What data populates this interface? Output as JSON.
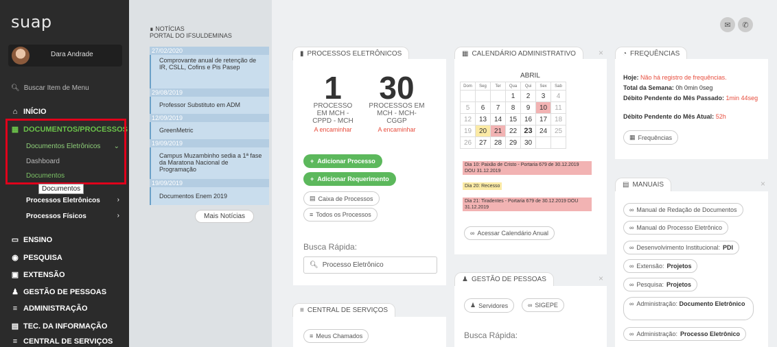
{
  "sidebar": {
    "logo": "suap",
    "user_name": "Dara Andrade",
    "search_placeholder": "Buscar Item de Menu",
    "items": {
      "inicio": "INÍCIO",
      "documentos": "DOCUMENTOS/PROCESSOS",
      "doc_eletronicos": "Documentos Eletrônicos",
      "dashboard": "Dashboard",
      "documentos_sub": "Documentos",
      "proc_eletronicos": "Processos Eletrônicos",
      "proc_fisicos": "Processos Físicos",
      "ensino": "ENSINO",
      "pesquisa": "PESQUISA",
      "extensao": "EXTENSÃO",
      "gestao": "GESTÃO DE PESSOAS",
      "administracao": "ADMINISTRAÇÃO",
      "tec": "TEC. DA INFORMAÇÃO",
      "central": "CENTRAL DE SERVIÇOS"
    },
    "tooltip": "Documentos",
    "highlight_color": "#e0001b"
  },
  "news": {
    "title": "NOTÍCIAS",
    "subtitle": "PORTAL DO IFSULDEMINAS",
    "items": [
      {
        "date": "27/02/2020",
        "title": "Comprovante anual de retenção de IR, CSLL, Cofins e Pis Pasep"
      },
      {
        "date": "29/08/2019",
        "title": "Professor Substituto em ADM"
      },
      {
        "date": "12/09/2019",
        "title": "GreenMetric"
      },
      {
        "date": "19/09/2019",
        "title": "Campus Muzambinho sedia a 1ª fase da Maratona Nacional de Programação"
      },
      {
        "date": "19/09/2019",
        "title": "Documentos Enem 2019"
      }
    ],
    "more": "Mais Notícias"
  },
  "processos": {
    "tab": "PROCESSOS ELETRÔNICOS",
    "n1": "1",
    "label1": "PROCESSO EM MCH - CPPD - MCH",
    "action1": "A encaminhar",
    "n2": "30",
    "label2": "PROCESSOS EM MCH - MCH-CGGP",
    "action2": "A encaminhar",
    "btn_add_processo": "Adicionar Processo",
    "btn_add_requerimento": "Adicionar Requerimento",
    "caixa": "Caixa de Processos",
    "todos": "Todos os Processos",
    "busca_label": "Busca Rápida:",
    "busca_value": "Processo Eletrônico"
  },
  "central": {
    "tab": "CENTRAL DE SERVIÇOS",
    "meus_chamados": "Meus Chamados"
  },
  "calendario": {
    "tab": "CALENDÁRIO ADMINISTRATIVO",
    "month": "ABRIL",
    "weekdays": [
      "Dom",
      "Seg",
      "Ter",
      "Qua",
      "Qui",
      "Sex",
      "Sab"
    ],
    "events": [
      "Dia 10: Paixão de Cristo - Portaria 679 de 30.12.2019 DOU 31.12.2019",
      "Dia 20: Recesso",
      "Dia 21: Tiradentes - Portaria 679 de 30.12.2019 DOU 31.12.2019"
    ],
    "link": "Acessar Calendário Anual"
  },
  "gestao": {
    "tab": "GESTÃO DE PESSOAS",
    "servidores": "Servidores",
    "sigepe": "SIGEPE",
    "busca_label": "Busca Rápida:"
  },
  "frequencias": {
    "tab": "FREQUÊNCIAS",
    "hoje_label": "Hoje:",
    "hoje_value": "Não há registro de frequências.",
    "semana_label": "Total da Semana:",
    "semana_value": "0h 0min 0seg",
    "passado_label": "Débito Pendente do Mês Passado:",
    "passado_value": "1min 44seg",
    "atual_label": "Débito Pendente do Mês Atual:",
    "atual_value": "52h",
    "btn": "Frequências"
  },
  "manuais": {
    "tab": "MANUAIS",
    "items": [
      {
        "text": "Manual de Redação de Documentos",
        "bold": ""
      },
      {
        "text": "Manual do Processo Eletrônico",
        "bold": ""
      },
      {
        "text": "Desenvolvimento Institucional:",
        "bold": "PDI"
      },
      {
        "text": "Extensão:",
        "bold": "Projetos"
      },
      {
        "text": "Pesquisa:",
        "bold": "Projetos"
      },
      {
        "text": "Administração:",
        "bold": "Documento Eletrônico"
      },
      {
        "text": "Administração:",
        "bold": "Processo Eletrônico"
      }
    ]
  }
}
